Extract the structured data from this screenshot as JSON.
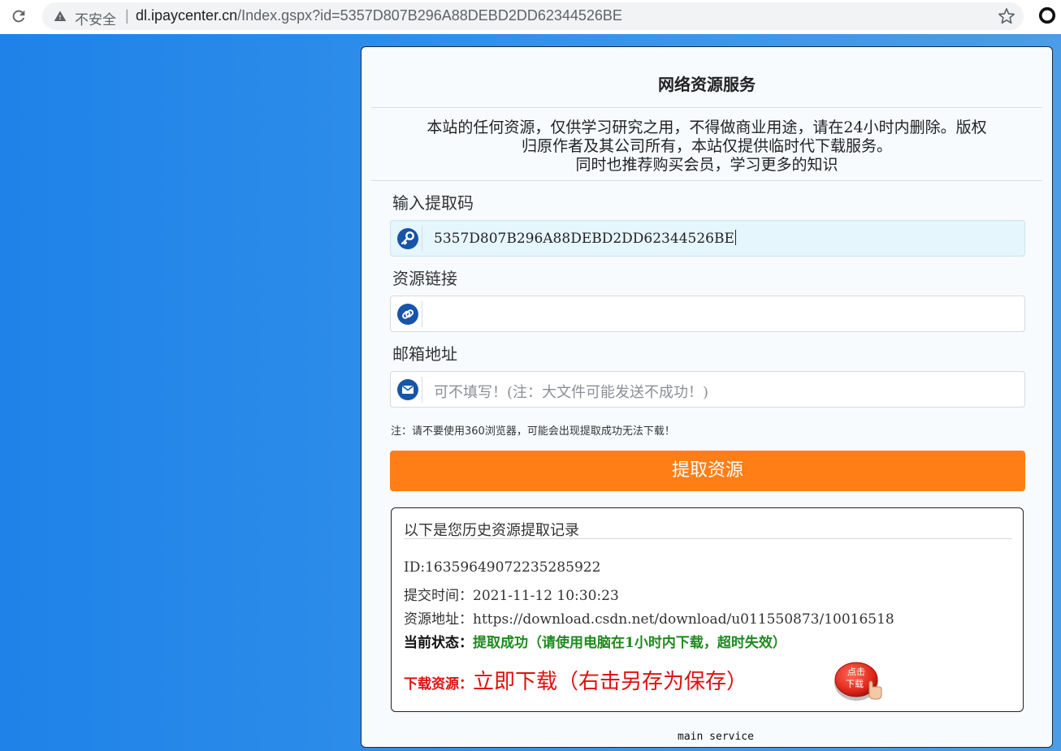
{
  "browser": {
    "security_label": "不安全",
    "separator": "|",
    "url_host": "dl.ipaycenter.cn",
    "url_path": "/Index.gspx?id=5357D807B296A88DEBD2DD62344526BE"
  },
  "page": {
    "title": "网络资源服务",
    "notice_lines": [
      "本站的任何资源，仅供学习研究之用，不得做商业用途，请在24小时内删除。版权",
      "归原作者及其公司所有，本站仅提供临时代下载服务。",
      "同时也推荐购买会员，学习更多的知识"
    ],
    "fields": {
      "code_label": "输入提取码",
      "code_value": "5357D807B296A88DEBD2DD62344526BE",
      "link_label": "资源链接",
      "link_value": "",
      "email_label": "邮箱地址",
      "email_placeholder": "可不填写！(注：大文件可能发送不成功！)"
    },
    "warning_note": "注：请不要使用360浏览器，可能会出现提取成功无法下载！",
    "submit_label": "提取资源",
    "history": {
      "title": "以下是您历史资源提取记录",
      "id_line": "ID:16359649072235285922",
      "time_line": "提交时间：2021-11-12 10:30:23",
      "url_line": "资源地址：https://download.csdn.net/download/u011550873/10016518",
      "status_key": "当前状态：",
      "status_value": "提取成功（请使用电脑在1小时内下载，超时失效）",
      "download_key": "下载资源：",
      "download_value": "立即下载（右击另存为保存）",
      "download_button_text_1": "点击",
      "download_button_text_2": "下载"
    },
    "footer": "main service"
  },
  "colors": {
    "accent_orange": "#ff7f16",
    "status_green": "#1e8a1e",
    "download_red": "#e01010",
    "background_blue": "#2b8be9"
  }
}
